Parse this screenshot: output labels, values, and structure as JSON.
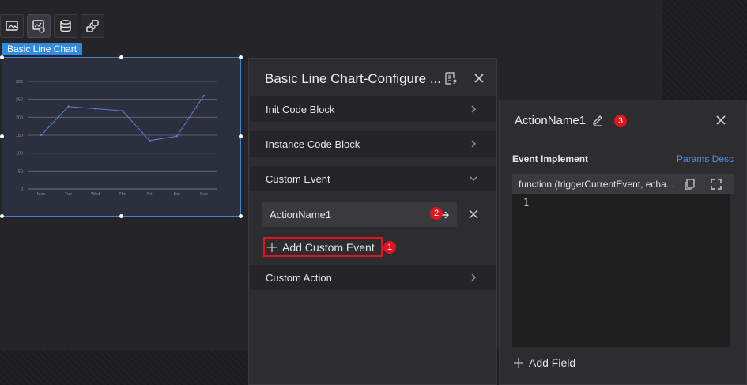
{
  "toolbar": {
    "tools": [
      "image-tool-icon",
      "chart-settings-icon",
      "database-icon",
      "linkage-icon"
    ]
  },
  "chart_widget": {
    "tag": "Basic Line Chart"
  },
  "chart_data": {
    "type": "line",
    "categories": [
      "Mon",
      "Tue",
      "Wed",
      "Thu",
      "Fri",
      "Sat",
      "Sun"
    ],
    "values": [
      150,
      230,
      224,
      218,
      135,
      147,
      260
    ],
    "yticks": [
      "0",
      "50",
      "100",
      "150",
      "200",
      "250",
      "300"
    ],
    "ylim": [
      0,
      300
    ],
    "grid": true,
    "line_color": "#5b7fd6"
  },
  "config_panel": {
    "title": "Basic Line Chart-Configure ...",
    "sections": {
      "init": "Init Code Block",
      "instance": "Instance Code Block",
      "custom_event": "Custom Event",
      "custom_action": "Custom Action"
    },
    "event_item": "ActionName1",
    "add_event": "Add Custom Event",
    "badge_1": "1",
    "badge_2": "2"
  },
  "action_panel": {
    "title": "ActionName1",
    "badge_3": "3",
    "event_implement": "Event Implement",
    "params_desc": "Params Desc",
    "code_signature": "function (triggerCurrentEvent, echa...",
    "line_number": "1",
    "add_field": "Add Field"
  },
  "colors": {
    "accent": "#2f8be0",
    "highlight": "#e0141e",
    "link": "#4d8fe8"
  }
}
